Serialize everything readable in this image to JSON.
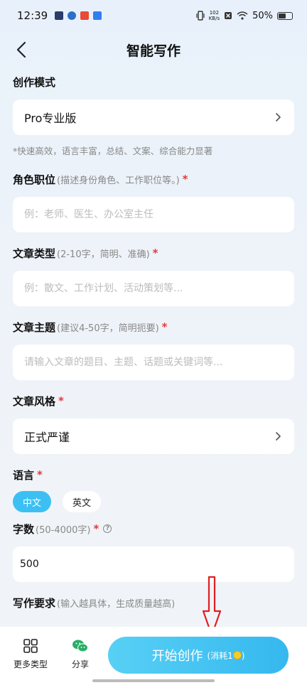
{
  "status": {
    "time": "12:39",
    "net_speed_top": "102",
    "net_speed_unit": "KB/s",
    "battery": "50%"
  },
  "nav": {
    "title": "智能写作"
  },
  "mode": {
    "label": "创作模式",
    "value": "Pro专业版",
    "note": "*快速高效，语言丰富，总结、文案、综合能力显著"
  },
  "role": {
    "label": "角色职位",
    "hint": "(描述身份角色、工作职位等。)",
    "required": "*",
    "placeholder": "例：老师、医生、办公室主任"
  },
  "article_type": {
    "label": "文章类型",
    "hint": "(2-10字，简明、准确)",
    "required": "*",
    "placeholder": "例：散文、工作计划、活动策划等..."
  },
  "topic": {
    "label": "文章主题",
    "hint": "(建议4-50字，简明扼要)",
    "required": "*",
    "placeholder": "请输入文章的题目、主题、话题或关键词等..."
  },
  "style": {
    "label": "文章风格",
    "required": "*",
    "value": "正式严谨"
  },
  "language": {
    "label": "语言",
    "required": "*",
    "options": [
      "中文",
      "英文"
    ],
    "selected": "中文"
  },
  "word_count": {
    "label": "字数",
    "hint": "(50-4000字)",
    "required": "*",
    "help": "?",
    "value": "500"
  },
  "requirements": {
    "label": "写作要求",
    "hint": "(输入越具体，生成质量越高)"
  },
  "bottom": {
    "more_types": "更多类型",
    "share": "分享",
    "start_label": "开始创作",
    "start_cost": "(消耗1",
    "start_cost_end": ")"
  },
  "colors": {
    "accent": "#3cc0f3",
    "required": "#e23b3b",
    "wechat": "#2aae67"
  }
}
